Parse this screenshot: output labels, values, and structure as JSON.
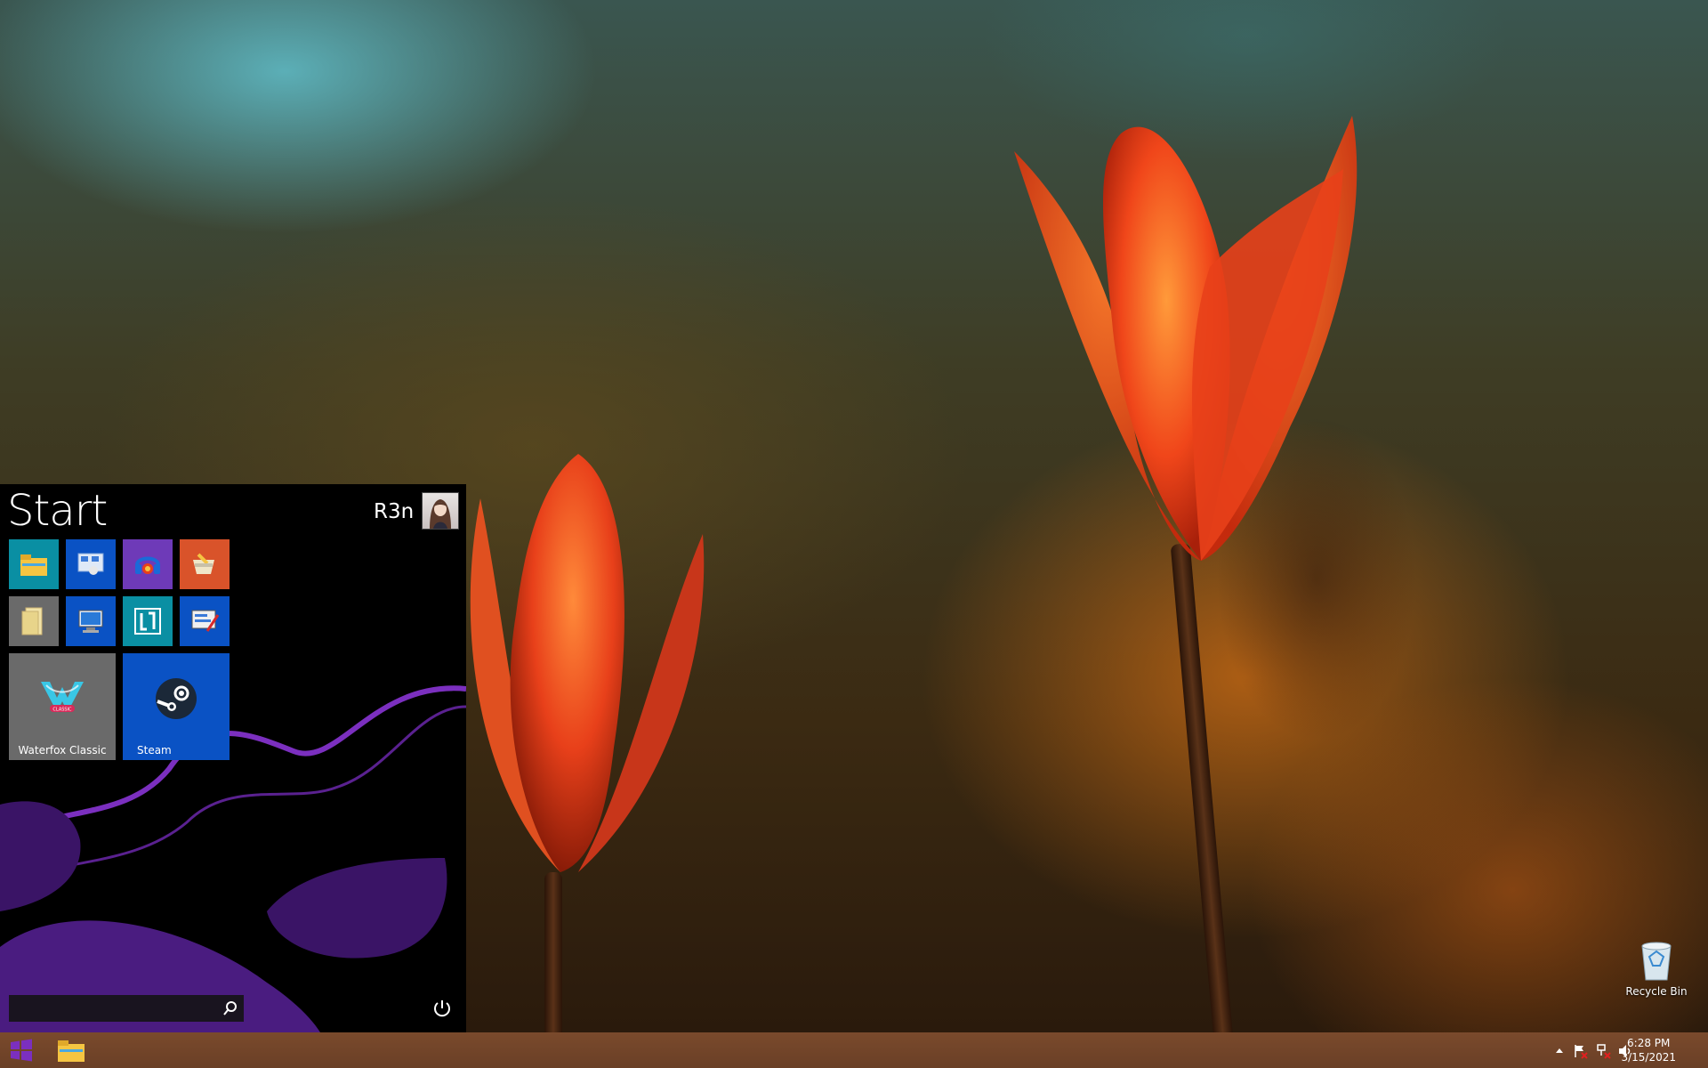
{
  "start_menu": {
    "title": "Start",
    "user_name": "R3n",
    "tiles": {
      "waterfox_label": "Waterfox Classic",
      "steam_label": "Steam"
    }
  },
  "desktop": {
    "recycle_bin_label": "Recycle Bin"
  },
  "taskbar": {
    "time": "6:28 PM",
    "date": "3/15/2021"
  },
  "colors": {
    "start_bg": "#000000",
    "accent_purple": "#7b2fbf",
    "taskbar": "#6f4329",
    "tile_blue": "#0a52c4",
    "tile_teal": "#0a8fa3",
    "tile_purple": "#6e3ab8",
    "tile_orange": "#d9532a",
    "tile_gray": "#6a6a6a"
  },
  "icons": [
    "file-explorer-icon",
    "control-panel-icon",
    "audio-app-icon",
    "ccleaner-icon",
    "folder-icon",
    "computer-icon",
    "lightshot-icon",
    "display-settings-icon",
    "waterfox-icon",
    "steam-icon",
    "search-icon",
    "power-icon",
    "recycle-bin-icon",
    "windows-logo-icon",
    "show-hidden-icons-icon",
    "action-center-flag-icon",
    "network-icon",
    "volume-icon"
  ]
}
